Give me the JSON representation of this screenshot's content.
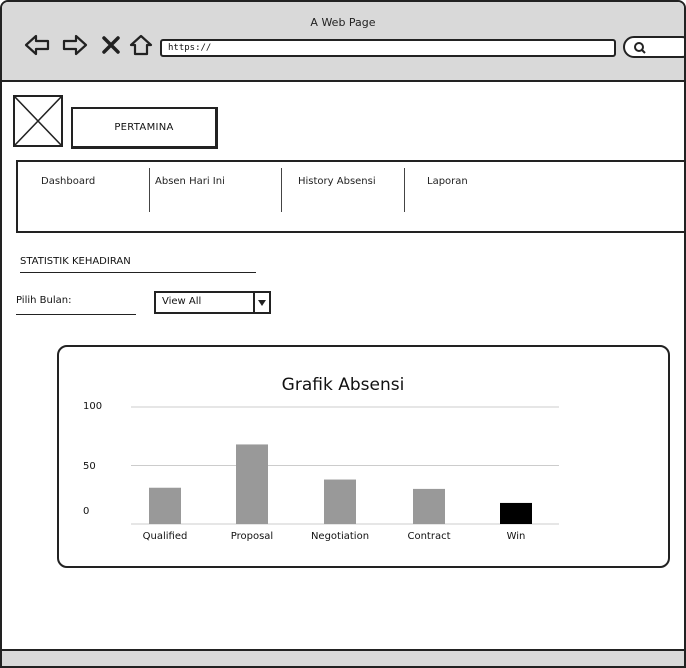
{
  "browser": {
    "title": "A Web Page",
    "url": "https://",
    "icons": [
      "back-arrow-icon",
      "forward-arrow-icon",
      "close-icon",
      "home-icon",
      "search-icon"
    ]
  },
  "header": {
    "brand_label": "PERTAMINA"
  },
  "nav": {
    "tabs": [
      {
        "label": "Dashboard"
      },
      {
        "label": "Absen Hari Ini"
      },
      {
        "label": "History Absensi"
      },
      {
        "label": "Laporan"
      }
    ]
  },
  "section": {
    "title": "STATISTIK KEHADIRAN",
    "month_label": "Pilih Bulan:",
    "month_select": "View All"
  },
  "chart_data": {
    "type": "bar",
    "title": "Grafik Absensi",
    "categories": [
      "Qualified",
      "Proposal",
      "Negotiation",
      "Contract",
      "Win"
    ],
    "values": [
      31,
      68,
      38,
      30,
      18
    ],
    "ylim": [
      0,
      100
    ],
    "yticks": [
      "0",
      "50",
      "100"
    ],
    "grid": true,
    "colors": {
      "bar": "#999999",
      "highlight": "#000000"
    },
    "highlight_index": 4
  }
}
